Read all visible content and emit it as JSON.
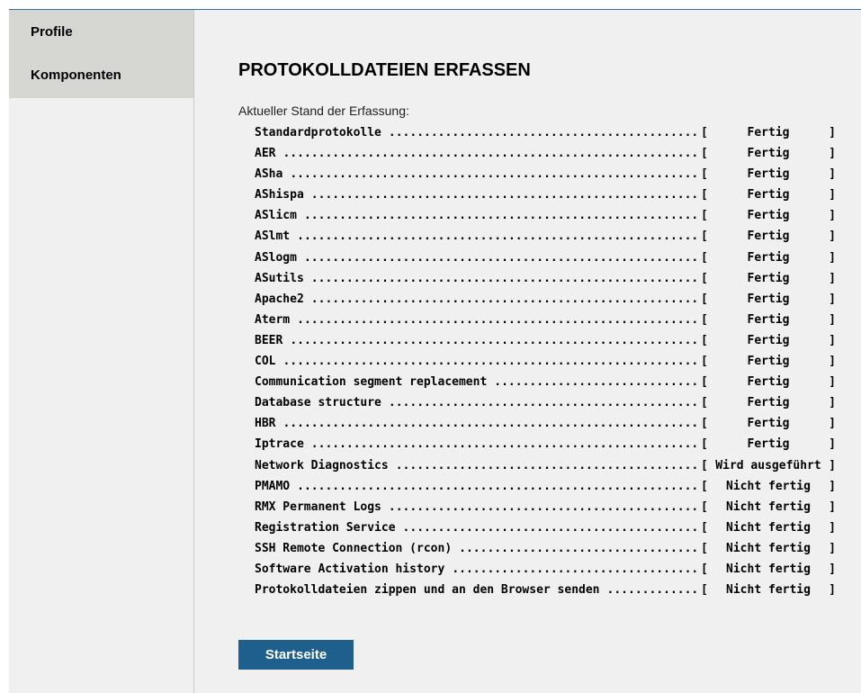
{
  "sidebar": {
    "items": [
      {
        "label": "Profile"
      },
      {
        "label": "Komponenten"
      }
    ]
  },
  "main": {
    "title": "PROTOKOLLDATEIEN ERFASSEN",
    "status_label": "Aktueller Stand der Erfassung:",
    "rows": [
      {
        "name": "Standardprotokolle",
        "status": "Fertig"
      },
      {
        "name": "AER",
        "status": "Fertig"
      },
      {
        "name": "ASha",
        "status": "Fertig"
      },
      {
        "name": "AShispa",
        "status": "Fertig"
      },
      {
        "name": "ASlicm",
        "status": "Fertig"
      },
      {
        "name": "ASlmt",
        "status": "Fertig"
      },
      {
        "name": "ASlogm",
        "status": "Fertig"
      },
      {
        "name": "ASutils",
        "status": "Fertig"
      },
      {
        "name": "Apache2",
        "status": "Fertig"
      },
      {
        "name": "Aterm",
        "status": "Fertig"
      },
      {
        "name": "BEER",
        "status": "Fertig"
      },
      {
        "name": "COL",
        "status": "Fertig"
      },
      {
        "name": "Communication segment replacement",
        "status": "Fertig"
      },
      {
        "name": "Database structure",
        "status": "Fertig"
      },
      {
        "name": "HBR",
        "status": "Fertig"
      },
      {
        "name": "Iptrace",
        "status": "Fertig"
      },
      {
        "name": "Network Diagnostics",
        "status": "Wird ausgeführt"
      },
      {
        "name": "PMAMO",
        "status": "Nicht fertig"
      },
      {
        "name": "RMX Permanent Logs",
        "status": "Nicht fertig"
      },
      {
        "name": "Registration Service",
        "status": "Nicht fertig"
      },
      {
        "name": "SSH Remote Connection (rcon)",
        "status": "Nicht fertig"
      },
      {
        "name": "Software Activation history",
        "status": "Nicht fertig"
      },
      {
        "name": "Protokolldateien zippen und an den Browser senden",
        "status": "Nicht fertig"
      }
    ],
    "start_button_label": "Startseite"
  }
}
